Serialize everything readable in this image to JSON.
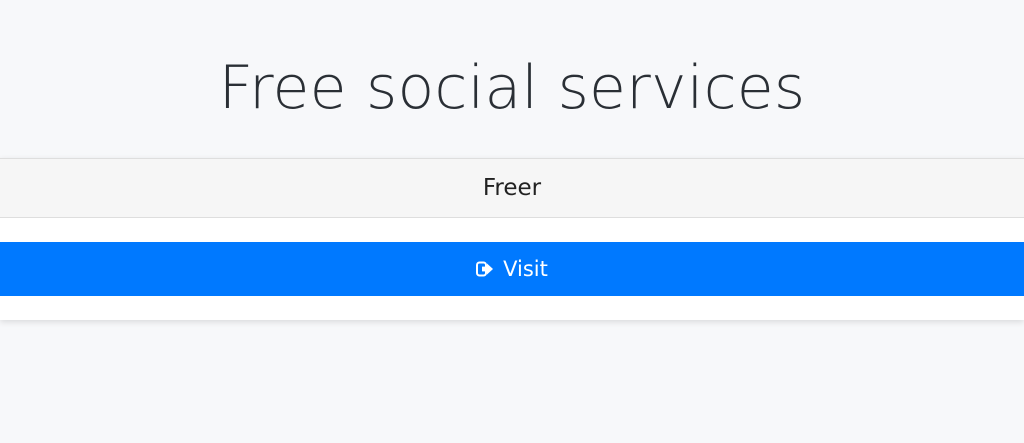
{
  "page": {
    "title": "Free social services"
  },
  "card": {
    "header": "Freer",
    "button_label": "Visit",
    "button_icon": "sign-out-icon",
    "button_color": "#0079ff"
  }
}
